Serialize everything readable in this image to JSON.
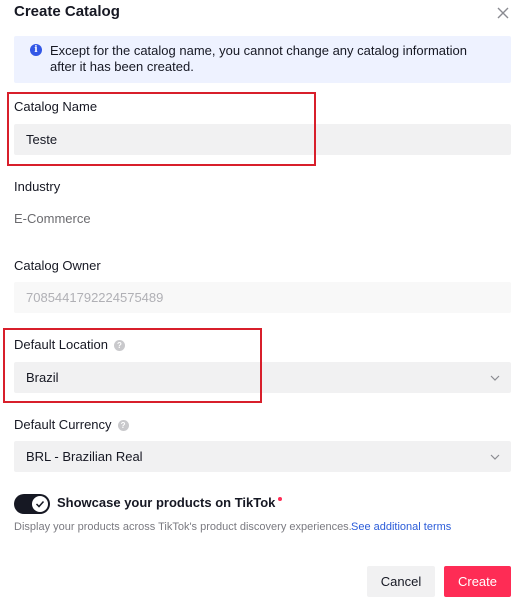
{
  "dialog": {
    "title": "Create Catalog",
    "notice": "Except for the catalog name, you cannot change any catalog information after it has been created."
  },
  "fields": {
    "catalog_name": {
      "label": "Catalog Name",
      "value": "Teste"
    },
    "industry": {
      "label": "Industry",
      "value": "E-Commerce"
    },
    "catalog_owner": {
      "label": "Catalog Owner",
      "value": "7085441792224575489"
    },
    "default_location": {
      "label": "Default Location",
      "value": "Brazil"
    },
    "default_currency": {
      "label": "Default Currency",
      "value": "BRL - Brazilian Real"
    }
  },
  "showcase": {
    "label": "Showcase your products on TikTok",
    "enabled": true,
    "description": "Display your products across TikTok's product discovery experiences.",
    "link": "See additional terms"
  },
  "buttons": {
    "cancel": "Cancel",
    "create": "Create"
  },
  "colors": {
    "accent": "#fe2c55",
    "info": "#3257e6",
    "highlight_box": "#d81f2b"
  }
}
